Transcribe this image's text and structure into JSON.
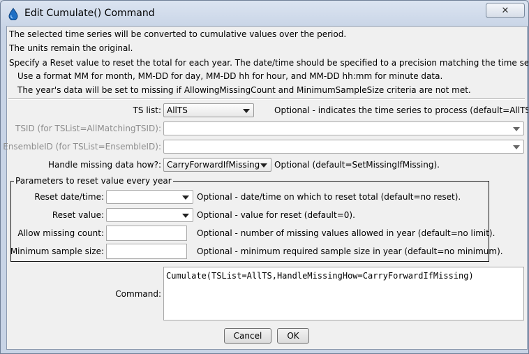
{
  "window": {
    "title": "Edit Cumulate() Command",
    "close_symbol": "✕"
  },
  "description": [
    "The selected time series will be converted to cumulative values over the period.",
    "The units remain the original.",
    "Specify a Reset value to reset the total for each year.  The date/time should be specified to a precision matching the time series.",
    "Use a format MM for month, MM-DD for day, MM-DD hh for hour, and MM-DD hh:mm for minute data.",
    "The year's data will be set to missing if AllowingMissingCount and MinimumSampleSize criteria are not met."
  ],
  "fields": {
    "ts_list": {
      "label": "TS list:",
      "value": "AllTS",
      "note": "Optional - indicates the time series to process (default=AllTS)."
    },
    "tsid": {
      "label": "TSID (for TSList=AllMatchingTSID):",
      "value": ""
    },
    "ensemble_id": {
      "label": "EnsembleID (for TSList=EnsembleID):",
      "value": ""
    },
    "handle_missing": {
      "label": "Handle missing data how?:",
      "value": "CarryForwardIfMissing",
      "note": "Optional (default=SetMissingIfMissing)."
    }
  },
  "reset_group": {
    "title": "Parameters to reset value every year",
    "reset_datetime": {
      "label": "Reset date/time:",
      "value": "",
      "note": "Optional - date/time on which to reset total (default=no reset)."
    },
    "reset_value": {
      "label": "Reset value:",
      "value": "",
      "note": "Optional - value for reset (default=0)."
    },
    "allow_missing_count": {
      "label": "Allow missing count:",
      "value": "",
      "note": "Optional - number of missing values allowed in year (default=no limit)."
    },
    "min_sample_size": {
      "label": "Minimum sample size:",
      "value": "",
      "note": "Optional - minimum required sample size in year (default=no minimum)."
    }
  },
  "command": {
    "label": "Command:",
    "text": "Cumulate(TSList=AllTS,HandleMissingHow=CarryForwardIfMissing)"
  },
  "buttons": {
    "cancel": "Cancel",
    "ok": "OK"
  },
  "colors": {
    "title_icon": "#1f6fc4",
    "disabled_text": "#8d8d8d"
  }
}
